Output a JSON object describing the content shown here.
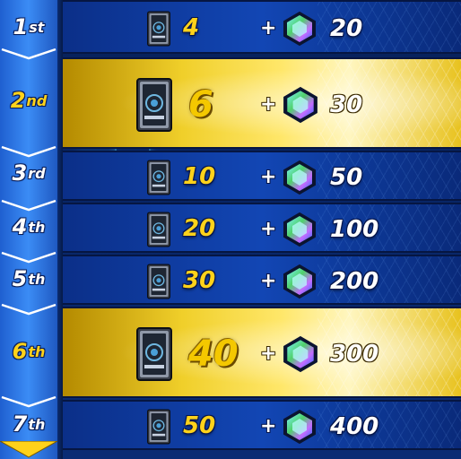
{
  "rewards": [
    {
      "rank_num": "1",
      "rank_suffix": "st",
      "cards": "4",
      "plus": "+",
      "gems": "20",
      "highlight": false
    },
    {
      "rank_num": "2",
      "rank_suffix": "nd",
      "cards": "6",
      "plus": "+",
      "gems": "30",
      "highlight": true
    },
    {
      "rank_num": "3",
      "rank_suffix": "rd",
      "cards": "10",
      "plus": "+",
      "gems": "50",
      "highlight": false
    },
    {
      "rank_num": "4",
      "rank_suffix": "th",
      "cards": "20",
      "plus": "+",
      "gems": "100",
      "highlight": false
    },
    {
      "rank_num": "5",
      "rank_suffix": "th",
      "cards": "30",
      "plus": "+",
      "gems": "200",
      "highlight": false
    },
    {
      "rank_num": "6",
      "rank_suffix": "th",
      "cards": "40",
      "plus": "+",
      "gems": "300",
      "highlight": true
    },
    {
      "rank_num": "7",
      "rank_suffix": "th",
      "cards": "50",
      "plus": "+",
      "gems": "400",
      "highlight": false
    }
  ],
  "icons": {
    "card": "card-pack-icon",
    "gem": "gem-icon"
  },
  "colors": {
    "row_blue": "#1246b4",
    "row_gold": "#f0cf2a",
    "quantity": "#ffd21a",
    "rank_gold": "#ffd21a",
    "rank_white": "#ffffff"
  }
}
